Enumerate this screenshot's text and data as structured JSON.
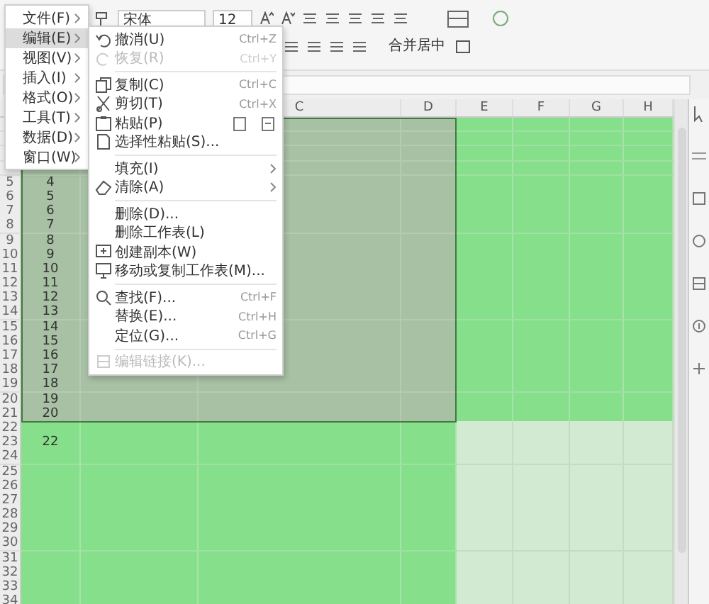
{
  "toolbar": {
    "font_name": "宋体",
    "font_size": "12",
    "merge_button": "合并居中"
  },
  "sheet": {
    "columns": [
      "C",
      "D",
      "E",
      "F",
      "G",
      "H"
    ],
    "rows": [
      {
        "number": "5",
        "value": "4",
        "selected": true
      },
      {
        "number": "6",
        "value": "5",
        "selected": true
      },
      {
        "number": "7",
        "value": "6",
        "selected": true
      },
      {
        "number": "8",
        "value": "7",
        "selected": true
      },
      {
        "number": "9",
        "value": "8",
        "selected": true
      },
      {
        "number": "10",
        "value": "9",
        "selected": true
      },
      {
        "number": "11",
        "value": "10",
        "selected": true
      },
      {
        "number": "12",
        "value": "11",
        "selected": true
      },
      {
        "number": "13",
        "value": "12",
        "selected": true
      },
      {
        "number": "14",
        "value": "13",
        "selected": true
      },
      {
        "number": "15",
        "value": "14",
        "selected": true
      },
      {
        "number": "16",
        "value": "15",
        "selected": true
      },
      {
        "number": "17",
        "value": "16",
        "selected": true
      },
      {
        "number": "18",
        "value": "17",
        "selected": true
      },
      {
        "number": "19",
        "value": "18",
        "selected": true
      },
      {
        "number": "20",
        "value": "19",
        "selected": true
      },
      {
        "number": "21",
        "value": "20",
        "selected": true
      },
      {
        "number": "22",
        "selected": false
      },
      {
        "number": "23",
        "value": "22",
        "selected": false
      },
      {
        "number": "24",
        "selected": false
      },
      {
        "number": "25",
        "selected": false
      },
      {
        "number": "26",
        "selected": false
      },
      {
        "number": "27",
        "selected": false
      },
      {
        "number": "28",
        "selected": false
      },
      {
        "number": "29",
        "selected": false
      },
      {
        "number": "30",
        "selected": false
      },
      {
        "number": "31",
        "selected": false
      },
      {
        "number": "32",
        "selected": false
      },
      {
        "number": "33",
        "selected": false
      },
      {
        "number": "34",
        "selected": false
      }
    ]
  },
  "main_menu": [
    {
      "label": "文件(F)",
      "selected": false,
      "submenu": true
    },
    {
      "label": "编辑(E)",
      "selected": true,
      "submenu": true
    },
    {
      "label": "视图(V)",
      "selected": false,
      "submenu": true
    },
    {
      "label": "插入(I)",
      "selected": false,
      "submenu": true
    },
    {
      "label": "格式(O)",
      "selected": false,
      "submenu": true
    },
    {
      "label": "工具(T)",
      "selected": false,
      "submenu": true
    },
    {
      "label": "数据(D)",
      "selected": false,
      "submenu": true
    },
    {
      "label": "窗口(W)",
      "selected": false,
      "submenu": true
    }
  ],
  "submenu": [
    {
      "kind": "item",
      "label": "撤消(U)",
      "shortcut": "Ctrl+Z",
      "disabled": false
    },
    {
      "kind": "item",
      "label": "恢复(R)",
      "shortcut": "Ctrl+Y",
      "disabled": true
    },
    {
      "kind": "separator"
    },
    {
      "kind": "item",
      "label": "复制(C)",
      "shortcut": "Ctrl+C",
      "disabled": false
    },
    {
      "kind": "item",
      "label": "剪切(T)",
      "shortcut": "Ctrl+X",
      "disabled": false
    },
    {
      "kind": "item",
      "label": "粘贴(P)",
      "disabled": false
    },
    {
      "kind": "item",
      "label": "选择性粘贴(S)...",
      "disabled": false
    },
    {
      "kind": "separator"
    },
    {
      "kind": "item",
      "label": "填充(I)",
      "disabled": false,
      "submenu": true
    },
    {
      "kind": "item",
      "label": "清除(A)",
      "disabled": false,
      "submenu": true
    },
    {
      "kind": "separator"
    },
    {
      "kind": "item",
      "label": "删除(D)...",
      "disabled": false
    },
    {
      "kind": "item",
      "label": "删除工作表(L)",
      "disabled": false
    },
    {
      "kind": "item",
      "label": "创建副本(W)",
      "disabled": false
    },
    {
      "kind": "item",
      "label": "移动或复制工作表(M)...",
      "disabled": false
    },
    {
      "kind": "separator"
    },
    {
      "kind": "item",
      "label": "查找(F)...",
      "shortcut": "Ctrl+F",
      "disabled": false
    },
    {
      "kind": "item",
      "label": "替换(E)...",
      "shortcut": "Ctrl+H",
      "disabled": false
    },
    {
      "kind": "item",
      "label": "定位(G)...",
      "shortcut": "Ctrl+G",
      "disabled": false
    },
    {
      "kind": "separator"
    },
    {
      "kind": "item",
      "label": "编辑链接(K)...",
      "disabled": true
    }
  ]
}
